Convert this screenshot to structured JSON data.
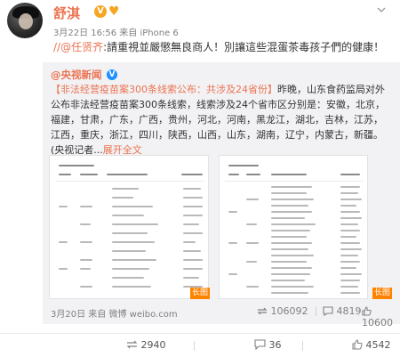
{
  "post": {
    "username": "舒淇",
    "vip_badge": "V",
    "meta": "3月22日 16:56 来自 iPhone 6",
    "mention": "//@任贤齐",
    "text": ":請重視並嚴懲無良商人！別讓這些混蛋茶毒孩子們的健康！"
  },
  "repost": {
    "username": "@央视新闻",
    "verified_badge": "V",
    "headline": "【非法经营疫苗案300条线索公布：共涉及24省份】",
    "body": "昨晚，山东食药监局对外公布非法经营疫苗案300条线索，线索涉及24个省市区分别是：安徽，北京，福建，甘肃，广东，广西，贵州，河北，河南，黑龙江，湖北，吉林，江苏，江西，重庆，浙江，四川，陕西，山西，山东，湖南，辽宁，内蒙古，新疆。(央视记者...",
    "expand_label": "展开全文",
    "images": [
      {
        "label": "长图"
      },
      {
        "label": "长图"
      }
    ],
    "date": "3月20日",
    "source": "来自 微博 weibo.com",
    "reposts": "106092",
    "comments": "4819",
    "likes": "10600"
  },
  "footer": {
    "reposts": "2940",
    "comments": "36",
    "likes": "4542"
  },
  "colors": {
    "accent": "#eb7350",
    "text": "#333333",
    "muted": "#808080",
    "repost_bg": "#f2f2f5",
    "long_image_badge": "#ff8200"
  }
}
